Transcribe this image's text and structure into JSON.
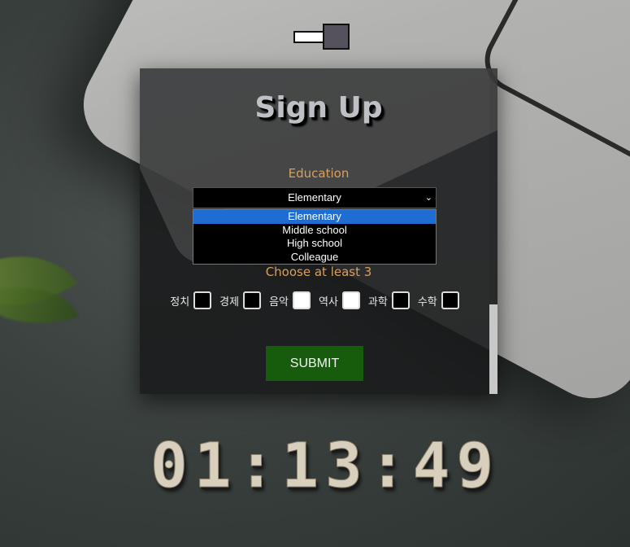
{
  "theme_toggle": {
    "state": "dark"
  },
  "form": {
    "title": "Sign Up",
    "education_label": "Education",
    "education_selected": "Elementary",
    "education_options": [
      "Elementary",
      "Middle school",
      "High school",
      "Colleague"
    ],
    "choose_label": "Choose at least 3",
    "subjects": [
      {
        "label": "정치",
        "checked": false
      },
      {
        "label": "경제",
        "checked": false
      },
      {
        "label": "음악",
        "checked": true
      },
      {
        "label": "역사",
        "checked": true
      },
      {
        "label": "과학",
        "checked": false
      },
      {
        "label": "수학",
        "checked": false
      }
    ],
    "submit_label": "SUBMIT"
  },
  "clock": {
    "hours": "01",
    "minutes": "13",
    "seconds": "49",
    "separator": ":"
  },
  "colors": {
    "label": "#d9a05b",
    "submit_bg": "#165c0c",
    "option_highlight": "#1f6cd3"
  }
}
